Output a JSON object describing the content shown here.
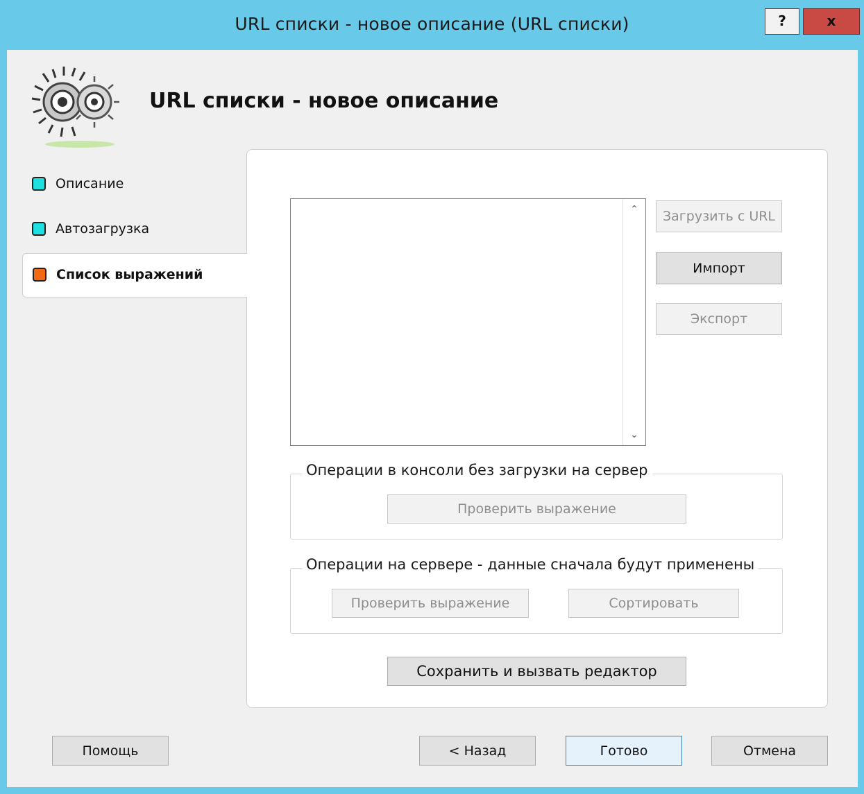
{
  "window": {
    "title": "URL списки - новое описание (URL списки)",
    "help_label": "?",
    "close_label": "x"
  },
  "header": {
    "title": "URL списки - новое описание",
    "logo_icon": "gears-icon"
  },
  "sidebar": {
    "items": [
      {
        "label": "Описание",
        "color": "#1fe0e0",
        "active": false
      },
      {
        "label": "Автозагрузка",
        "color": "#1fe0e0",
        "active": false
      },
      {
        "label": "Список выражений",
        "color": "#f26a13",
        "active": true
      }
    ]
  },
  "expressions": {
    "list_items": [],
    "load_url_label": "Загрузить с URL",
    "import_label": "Импорт",
    "export_label": "Экспорт"
  },
  "console_group": {
    "label": "Операции в консоли без загрузки на сервер",
    "check_label": "Проверить выражение"
  },
  "server_group": {
    "label": "Операции на сервере - данные сначала будут применены",
    "check_label": "Проверить выражение",
    "sort_label": "Сортировать"
  },
  "save_editor_label": "Сохранить и вызвать редактор",
  "footer": {
    "help_label": "Помощь",
    "back_label": "< Назад",
    "finish_label": "Готово",
    "cancel_label": "Отмена"
  }
}
